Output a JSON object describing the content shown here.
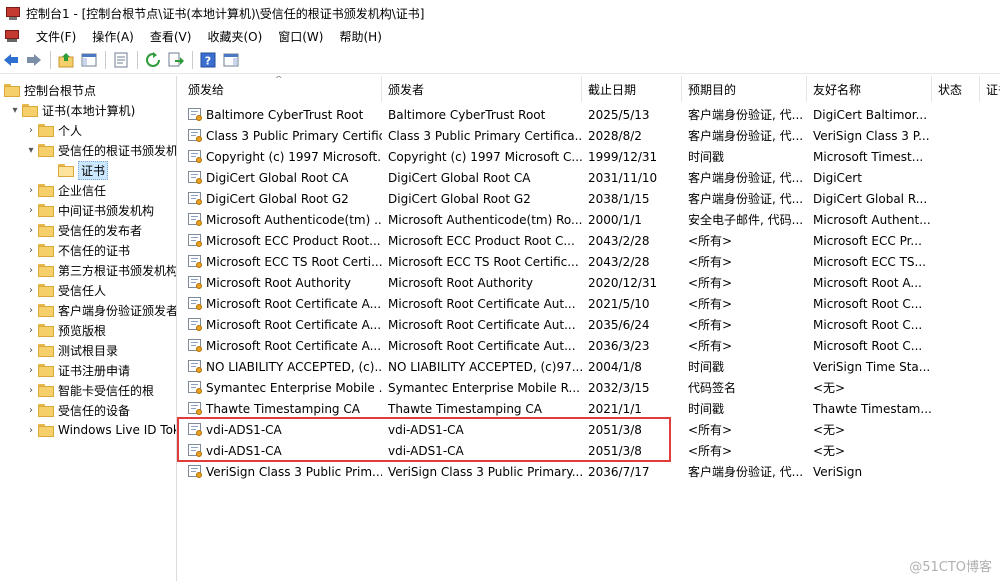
{
  "window": {
    "title": "控制台1 - [控制台根节点\\证书(本地计算机)\\受信任的根证书颁发机构\\证书]"
  },
  "menu": [
    "文件(F)",
    "操作(A)",
    "查看(V)",
    "收藏夹(O)",
    "窗口(W)",
    "帮助(H)"
  ],
  "toolbar_icons": [
    "back-arrow-icon",
    "forward-arrow-icon",
    "up-folder-icon",
    "show-hide-tree-icon",
    "properties-icon",
    "refresh-icon",
    "export-list-icon",
    "help-icon",
    "show-hide-action-pane-icon"
  ],
  "tree": [
    {
      "label": "控制台根节点",
      "exp": "",
      "selected": false,
      "open": false
    },
    {
      "label": "证书(本地计算机)",
      "exp": "▾",
      "selected": false,
      "open": false
    },
    {
      "label": "个人",
      "exp": "›",
      "selected": false,
      "open": false
    },
    {
      "label": "受信任的根证书颁发机构",
      "exp": "▾",
      "selected": false,
      "open": false
    },
    {
      "label": "证书",
      "exp": "",
      "selected": true,
      "open": true
    },
    {
      "label": "企业信任",
      "exp": "›",
      "selected": false,
      "open": false
    },
    {
      "label": "中间证书颁发机构",
      "exp": "›",
      "selected": false,
      "open": false
    },
    {
      "label": "受信任的发布者",
      "exp": "›",
      "selected": false,
      "open": false
    },
    {
      "label": "不信任的证书",
      "exp": "›",
      "selected": false,
      "open": false
    },
    {
      "label": "第三方根证书颁发机构",
      "exp": "›",
      "selected": false,
      "open": false
    },
    {
      "label": "受信任人",
      "exp": "›",
      "selected": false,
      "open": false
    },
    {
      "label": "客户端身份验证颁发者",
      "exp": "›",
      "selected": false,
      "open": false
    },
    {
      "label": "预览版根",
      "exp": "›",
      "selected": false,
      "open": false
    },
    {
      "label": "测试根目录",
      "exp": "›",
      "selected": false,
      "open": false
    },
    {
      "label": "证书注册申请",
      "exp": "›",
      "selected": false,
      "open": false
    },
    {
      "label": "智能卡受信任的根",
      "exp": "›",
      "selected": false,
      "open": false
    },
    {
      "label": "受信任的设备",
      "exp": "›",
      "selected": false,
      "open": false
    },
    {
      "label": "Windows Live ID Token Issuer",
      "exp": "›",
      "selected": false,
      "open": false
    }
  ],
  "columns": [
    "颁发给",
    "颁发者",
    "截止日期",
    "预期目的",
    "友好名称",
    "状态",
    "证书模板"
  ],
  "sort_glyph": "^",
  "rows": [
    [
      "Baltimore CyberTrust Root",
      "Baltimore CyberTrust Root",
      "2025/5/13",
      "客户端身份验证, 代...",
      "DigiCert Baltimor..."
    ],
    [
      "Class 3 Public Primary Certific...",
      "Class 3 Public Primary Certifica...",
      "2028/8/2",
      "客户端身份验证, 代...",
      "VeriSign Class 3 P..."
    ],
    [
      "Copyright (c) 1997 Microsoft...",
      "Copyright (c) 1997 Microsoft C...",
      "1999/12/31",
      "时间戳",
      "Microsoft Timest..."
    ],
    [
      "DigiCert Global Root CA",
      "DigiCert Global Root CA",
      "2031/11/10",
      "客户端身份验证, 代...",
      "DigiCert"
    ],
    [
      "DigiCert Global Root G2",
      "DigiCert Global Root G2",
      "2038/1/15",
      "客户端身份验证, 代...",
      "DigiCert Global R..."
    ],
    [
      "Microsoft Authenticode(tm) ...",
      "Microsoft Authenticode(tm) Ro...",
      "2000/1/1",
      "安全电子邮件, 代码...",
      "Microsoft Authent..."
    ],
    [
      "Microsoft ECC Product Root...",
      "Microsoft ECC Product Root C...",
      "2043/2/28",
      "<所有>",
      "Microsoft ECC Pr..."
    ],
    [
      "Microsoft ECC TS Root Certi...",
      "Microsoft ECC TS Root Certific...",
      "2043/2/28",
      "<所有>",
      "Microsoft ECC TS..."
    ],
    [
      "Microsoft Root Authority",
      "Microsoft Root Authority",
      "2020/12/31",
      "<所有>",
      "Microsoft Root A..."
    ],
    [
      "Microsoft Root Certificate A...",
      "Microsoft Root Certificate Aut...",
      "2021/5/10",
      "<所有>",
      "Microsoft Root C..."
    ],
    [
      "Microsoft Root Certificate A...",
      "Microsoft Root Certificate Aut...",
      "2035/6/24",
      "<所有>",
      "Microsoft Root C..."
    ],
    [
      "Microsoft Root Certificate A...",
      "Microsoft Root Certificate Aut...",
      "2036/3/23",
      "<所有>",
      "Microsoft Root C..."
    ],
    [
      "NO LIABILITY ACCEPTED, (c)...",
      "NO LIABILITY ACCEPTED, (c)97...",
      "2004/1/8",
      "时间戳",
      "VeriSign Time Sta..."
    ],
    [
      "Symantec Enterprise Mobile ...",
      "Symantec Enterprise Mobile R...",
      "2032/3/15",
      "代码签名",
      "<无>"
    ],
    [
      "Thawte Timestamping CA",
      "Thawte Timestamping CA",
      "2021/1/1",
      "时间戳",
      "Thawte Timestam..."
    ],
    [
      "vdi-ADS1-CA",
      "vdi-ADS1-CA",
      "2051/3/8",
      "<所有>",
      "<无>"
    ],
    [
      "vdi-ADS1-CA",
      "vdi-ADS1-CA",
      "2051/3/8",
      "<所有>",
      "<无>"
    ],
    [
      "VeriSign Class 3 Public Prim...",
      "VeriSign Class 3 Public Primary...",
      "2036/7/17",
      "客户端身份验证, 代...",
      "VeriSign"
    ]
  ],
  "watermark": "@51CTO博客",
  "colors": {
    "highlight": "#e23b3b",
    "selection": "#cce8ff",
    "folder": "#f5cf6a"
  }
}
